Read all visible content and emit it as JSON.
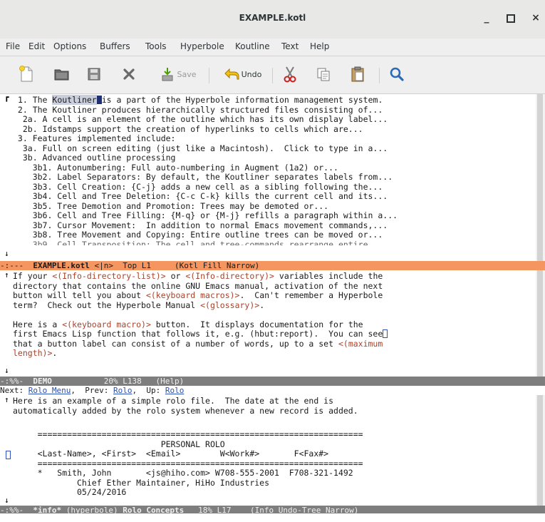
{
  "window": {
    "title": "EXAMPLE.kotl",
    "minimize": "_",
    "close": "×"
  },
  "menubar": [
    "File",
    "Edit",
    "Options",
    "Buffers",
    "Tools",
    "Hyperbole",
    "Koutline",
    "Text",
    "Help"
  ],
  "toolbar": {
    "save_label": "Save",
    "undo_label": "Undo"
  },
  "kotl": {
    "line0_pre": "1. The ",
    "line0_word": "Koutliner",
    "line0_post": "is a part of the Hyperbole information management system.",
    "lines": [
      " 2. The Koutliner produces hierarchically structured files consisting of...",
      "  2a. A cell is an element of the outline which has its own display label...",
      "  2b. Idstamps support the creation of hyperlinks to cells which are...",
      " 3. Features implemented include:",
      "  3a. Full on screen editing (just like a Macintosh).  Click to type in a...",
      "  3b. Advanced outline processing",
      "    3b1. Autonumbering: Full auto-numbering in Augment (1a2) or...",
      "    3b2. Label Separators: By default, the Koutliner separates labels from...",
      "    3b3. Cell Creation: {C-j} adds a new cell as a sibling following the...",
      "    3b4. Cell and Tree Deletion: {C-c C-k} kills the current cell and its...",
      "    3b5. Tree Demotion and Promotion: Trees may be demoted or...",
      "    3b6. Cell and Tree Filling: {M-q} or {M-j} refills a paragraph within a...",
      "    3b7. Cursor Movement:  In addition to normal Emacs movement commands,...",
      "    3b8. Tree Movement and Copying: Entire outline trees can be moved or..."
    ],
    "modeline_pre": "-:---  ",
    "modeline_buffer": "EXAMPLE.kotl",
    "modeline_post": " <|n>  Top L1     (Kotl Fill Narrow)"
  },
  "demo": {
    "p1_l1_a": "If your ",
    "p1_l1_link1": "<(Info-directory-list)>",
    "p1_l1_b": " or ",
    "p1_l1_link2": "<(Info-directory)>",
    "p1_l1_c": " variables include the",
    "p1_l2": "directory that contains the online GNU Emacs manual, activation of the next",
    "p1_l3_a": "button will tell you about ",
    "p1_l3_link": "<(keyboard macros)>",
    "p1_l3_b": ".  Can't remember a Hyperbole",
    "p1_l4_a": "term?  Check out the Hyperbole Manual ",
    "p1_l4_link": "<(glossary)>",
    "p1_l4_b": ".",
    "p2_l1_a": "Here is a ",
    "p2_l1_link": "<(keyboard macro)>",
    "p2_l1_b": " button.  It displays documentation for the",
    "p2_l2": "first Emacs Lisp function that follows it, e.g. (hbut:report).  You can see",
    "p2_l3_a": "that a button label can consist of a number of words, up to a set ",
    "p2_l3_link": "<(maximum",
    "p2_l4_link": "length)>",
    "p2_l4_b": ".",
    "modeline_pre": "-:%%-  ",
    "modeline_buffer": "DEMO",
    "modeline_post": "           20% L138   (Help)"
  },
  "info": {
    "header_next_label": "Next: ",
    "header_next": "Rolo Menu",
    "header_prev_label": ",  Prev: ",
    "header_prev": "Rolo",
    "header_up_label": ",  Up: ",
    "header_up": "Rolo",
    "l1": "Here is an example of a simple rolo file.  The date at the end is",
    "l2": "automatically added by the rolo system whenever a new record is added.",
    "rule1": "     ==================================================================",
    "title": "                              PERSONAL ROLO",
    "fields": "     <Last-Name>, <First>  <Email>        W<Work#>       F<Fax#>",
    "rule2": "     ==================================================================",
    "rec1": "     *   Smith, John       <js@hiho.com> W708-555-2001  F708-321-1492",
    "rec2": "             Chief Ether Maintainer, HiHo Industries",
    "rec3": "             05/24/2016",
    "modeline_pre": "-:%%-  ",
    "modeline_buffer": "*info*",
    "modeline_mid": " (hyperbole) ",
    "modeline_node": "Rolo Concepts",
    "modeline_post": "   18% L17    (Info Undo-Tree Narrow)"
  }
}
